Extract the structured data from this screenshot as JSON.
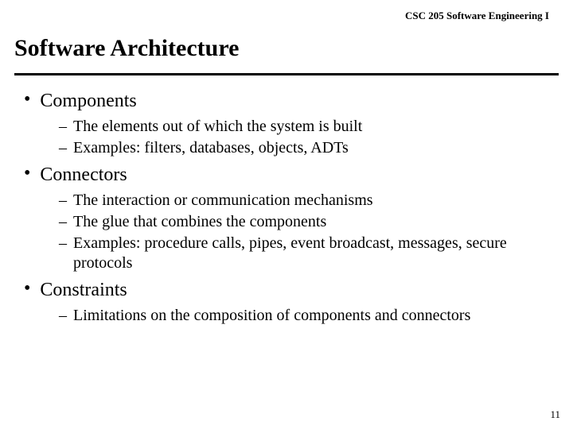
{
  "course_header": "CSC 205 Software Engineering I",
  "title": "Software Architecture",
  "bullets": [
    {
      "label": "Components",
      "subs": [
        "The elements out of which the system is built",
        "Examples:  filters, databases, objects, ADTs"
      ]
    },
    {
      "label": "Connectors",
      "subs": [
        "The interaction or communication mechanisms",
        "The glue that combines the components",
        "Examples:  procedure calls, pipes, event broadcast, messages, secure protocols"
      ]
    },
    {
      "label": "Constraints",
      "subs": [
        "Limitations on the composition of components and connectors"
      ]
    }
  ],
  "page_number": "11"
}
